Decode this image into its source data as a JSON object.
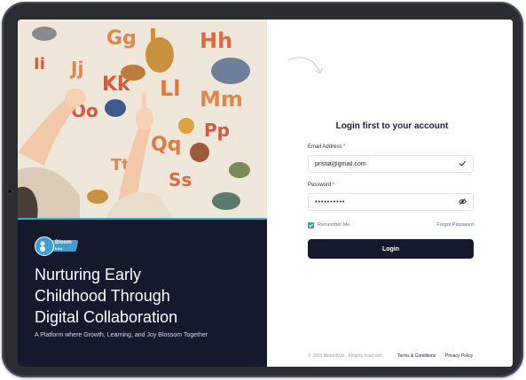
{
  "brand": {
    "logo_line1": "Bloom",
    "logo_line2": "Kidz"
  },
  "hero": {
    "headline_line1": "Nurturing Early",
    "headline_line2": "Childhood Through",
    "headline_line3": "Digital Collaboration",
    "tagline": "A Platform where Growth, Learning, and Joy Blossom Together"
  },
  "form": {
    "title": "Login first to your account",
    "email_label": "Email Address",
    "email_value": "pristia@gmail.com",
    "password_label": "Password",
    "password_value": "••••••••••",
    "required_mark": "*",
    "remember_label": "Remember Me",
    "remember_checked": true,
    "forgot_label": "Forgot Password",
    "login_label": "Login"
  },
  "footer": {
    "copyright": "© 2023 BloomKidz . Alrights reserved",
    "terms": "Terms & Conditions",
    "privacy": "Privacy Policy"
  },
  "icons": {
    "email_valid": "check-icon",
    "password_toggle": "eye-icon",
    "remember": "checkbox-checked-icon",
    "decor": "curved-arrow-icon"
  },
  "colors": {
    "panel_dark": "#141a2b",
    "accent_teal": "#2fa3b8",
    "logo_blue": "#3c9fd6",
    "required_red": "#e0453d"
  }
}
